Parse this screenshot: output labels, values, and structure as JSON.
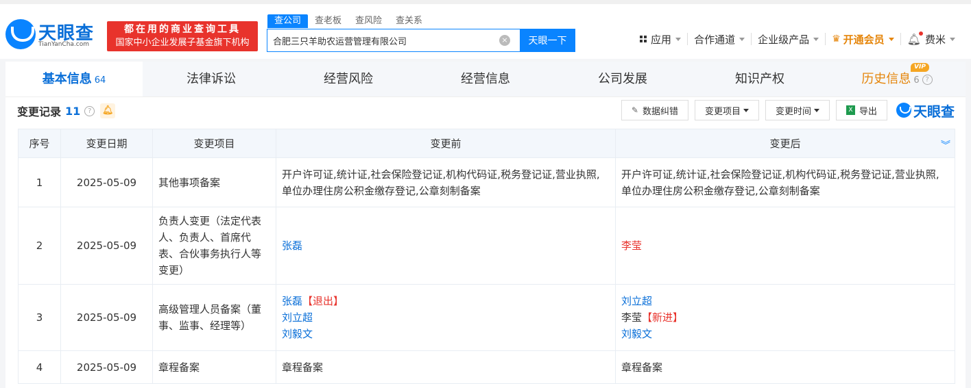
{
  "brand": {
    "name": "天眼查",
    "domain": "TianYanCha.com",
    "slogan_line1": "都在用的商业查询工具",
    "slogan_line2": "国家中小企业发展子基金旗下机构"
  },
  "search": {
    "tabs": [
      "查公司",
      "查老板",
      "查风险",
      "查关系"
    ],
    "value": "合肥三只羊助农运营管理有限公司",
    "button": "天眼一下"
  },
  "topnav": {
    "apps": "应用",
    "partner": "合作通道",
    "enterprise": "企业级产品",
    "vip": "开通会员",
    "user": "费米"
  },
  "tabs": [
    {
      "label": "基本信息",
      "count": "64"
    },
    {
      "label": "法律诉讼"
    },
    {
      "label": "经营风险"
    },
    {
      "label": "经营信息"
    },
    {
      "label": "公司发展"
    },
    {
      "label": "知识产权"
    },
    {
      "label": "历史信息",
      "count": "6",
      "badge": "VIP"
    }
  ],
  "section": {
    "title": "变更记录",
    "count": "11",
    "toolbar": {
      "fix": "数据纠错",
      "item": "变更项目",
      "time": "变更时间",
      "export": "导出"
    }
  },
  "table": {
    "headers": [
      "序号",
      "变更日期",
      "变更项目",
      "变更前",
      "变更后"
    ],
    "rows": [
      {
        "no": "1",
        "date": "2025-05-09",
        "item": "其他事项备案",
        "before": "开户许可证,统计证,社会保险登记证,机构代码证,税务登记证,营业执照,单位办理住房公积金缴存登记,公章刻制备案",
        "after": "开户许可证,统计证,社会保险登记证,机构代码证,税务登记证,营业执照,单位办理住房公积金缴存登记,公章刻制备案"
      },
      {
        "no": "2",
        "date": "2025-05-09",
        "item": "负责人变更（法定代表人、负责人、首席代表、合伙事务执行人等变更）",
        "before": "张磊",
        "after": "李莹"
      },
      {
        "no": "3",
        "date": "2025-05-09",
        "item": "高级管理人员备案（董事、监事、经理等）",
        "before_1": "张磊",
        "before_1_tag": "【退出】",
        "before_2": "刘立超",
        "before_3": "刘毅文",
        "after_1": "刘立超",
        "after_2": "李莹",
        "after_2_tag": "【新进】",
        "after_3": "刘毅文"
      },
      {
        "no": "4",
        "date": "2025-05-09",
        "item": "章程备案",
        "before": "章程备案",
        "after": "章程备案"
      }
    ]
  }
}
